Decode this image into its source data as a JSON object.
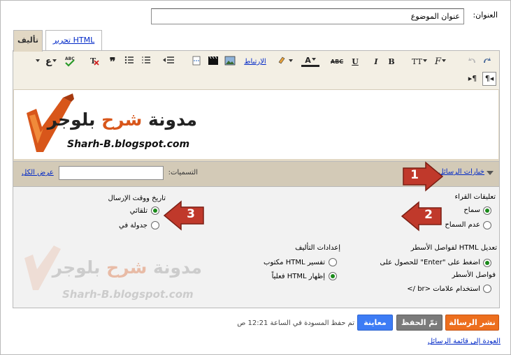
{
  "title_field": {
    "label": "العنوان:",
    "value": "عنوان الموضوع"
  },
  "tabs": {
    "compose": "تأليف",
    "edit_html": "تحرير HTML"
  },
  "toolbar": {
    "font_icon": "font-family-icon",
    "font_size_icon": "font-size-icon",
    "bold": "B",
    "italic": "I",
    "underline": "U",
    "strike": "ABC",
    "text_color": "A",
    "link_label": "الإرتباط",
    "lang_label": "ع",
    "spell_label": "ABC"
  },
  "content_logo": {
    "title_part1": "مدونة ",
    "title_part2": "شرح",
    "title_part3": " بلوجر",
    "url": "Sharh-B.blogspot.com"
  },
  "options_bar": {
    "post_options_link": "خيارات الرسائل",
    "labels_label": "التسميات:",
    "labels_value": "",
    "show_all_link": "عرض الكل"
  },
  "options": {
    "comments": {
      "heading": "تعليقات القراء",
      "allow": "سماح",
      "disallow": "عدم السماح",
      "selected": "allow"
    },
    "post_date": {
      "heading": "تاريخ ووقت الإرسال",
      "automatic": "تلقائي",
      "scheduled": "جدولة في",
      "selected": "automatic"
    },
    "line_breaks": {
      "heading": "تعديل HTML لفواصل الأسطر",
      "enter_line1": "اضغط على \"Enter\" للحصول على",
      "enter_line2": "فواصل الأسطر",
      "br_tags": "استخدام علامات <br />",
      "selected": "enter"
    },
    "compose_settings": {
      "heading": "إعدادات التأليف",
      "interpret": "تفسير HTML مكتوب",
      "show_html": "إظهار HTML فعلياً",
      "selected": "show_html"
    }
  },
  "watermark": {
    "title_part1": "مدونة ",
    "title_part2": "شرح",
    "title_part3": " بلوجر",
    "url": "Sharh-B.blogspot.com"
  },
  "callouts": [
    "1",
    "2",
    "3"
  ],
  "buttons": {
    "publish": "نشر الرسالة",
    "save": "تمّ الحفظ",
    "preview": "معاينة"
  },
  "autosave_text": "تم حفظ المسودة في الساعة 12:21 ص",
  "back_link": "العودة إلى قائمة الرسائل",
  "colors": {
    "accent_orange": "#ed6f1e",
    "callout_red": "#c0392b",
    "link": "#0028c7",
    "toolbar_bg": "#e2d8c4"
  }
}
